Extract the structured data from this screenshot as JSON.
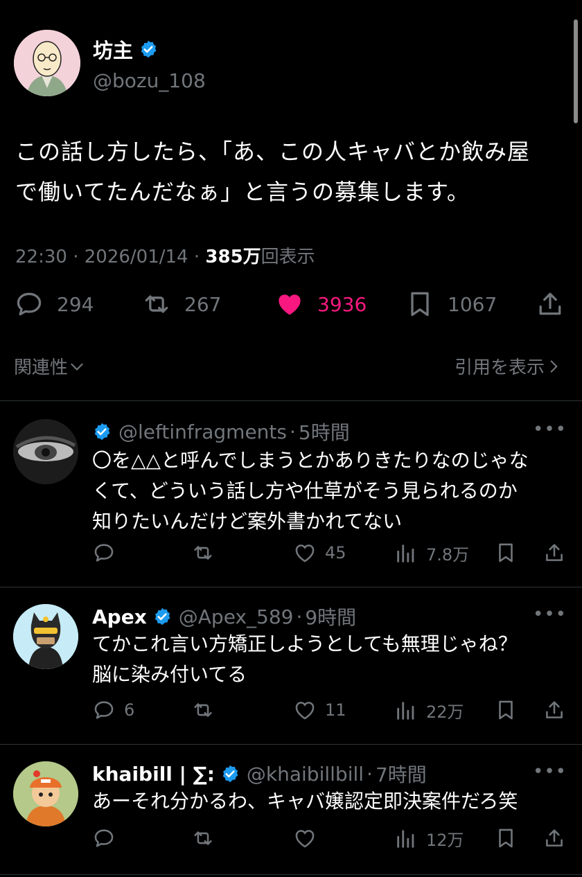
{
  "tweet": {
    "author_name": "坊主",
    "author_handle": "@bozu_108",
    "text_line1": "この話し方したら、「あ、この人キャバとか飲み屋",
    "text_line2": "で働いてたんだなぁ」と言うの募集します。",
    "time": "22:30",
    "date": "2026/01/14",
    "views_count": "385万",
    "views_label": "回表示",
    "replies": "294",
    "retweets": "267",
    "likes": "3936",
    "bookmarks": "1067",
    "related_label": "関連性",
    "quotes_label": "引用を表示"
  },
  "replies": [
    {
      "name": "",
      "handle": "@leftinfragments",
      "age": "5時間",
      "lines": [
        "〇を△△と呼んでしまうとかありきたりなのじゃな",
        "くて、どういう話し方や仕草がそう見られるのか",
        "知りたいんだけど案外書かれてない"
      ],
      "reply_count": "",
      "retweet_count": "",
      "like_count": "45",
      "views": "7.8万"
    },
    {
      "name": "Apex",
      "handle": "@Apex_589",
      "age": "9時間",
      "lines": [
        "てかこれ言い方矯正しようとしても無理じゃね？",
        "脳に染み付いてる"
      ],
      "reply_count": "6",
      "retweet_count": "",
      "like_count": "11",
      "views": "22万"
    },
    {
      "name": "khaibill | ∑:",
      "handle": "@khaibillbill",
      "age": "7時間",
      "lines": [
        "あーそれ分かるわ、キャバ嬢認定即決案件だろ笑"
      ],
      "reply_count": "",
      "retweet_count": "",
      "like_count": "",
      "views": "12万"
    }
  ],
  "colors": {
    "like_active": "#f91880",
    "verified": "#1d9bf0",
    "muted": "#71767b"
  },
  "icons": [
    "reply-icon",
    "retweet-icon",
    "heart-icon",
    "bookmark-icon",
    "share-icon",
    "views-icon",
    "verified-icon",
    "more-icon",
    "chevron-down-icon",
    "chevron-right-icon"
  ]
}
